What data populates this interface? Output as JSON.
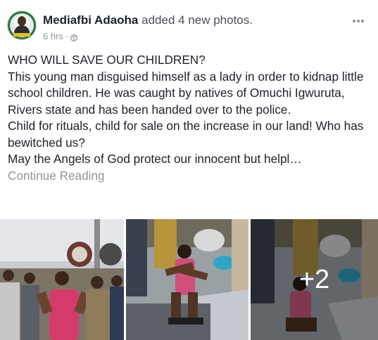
{
  "post": {
    "author": "Mediafbi Adaoha",
    "action": "added 4 new photos.",
    "timestamp": "6 hrs",
    "separator": "·",
    "privacy_icon": "globe-icon",
    "more_icon": "ellipsis-icon",
    "body_lines": [
      "WHO WILL SAVE OUR CHILDREN?",
      "This young man disguised himself as a lady in order to kidnap little school children. He was caught by natives of Omuchi Igwuruta, Rivers state and has been handed over to the police.",
      "Child for rituals, child for sale on the increase in our land! Who has bewitched us?",
      "May the Angels of God protect our innocent but helpl…"
    ],
    "continue_label": "Continue Reading",
    "photos": {
      "count_visible": 3,
      "more_overlay": "+2"
    }
  },
  "colors": {
    "author": "#1d2129",
    "secondary": "#90949c",
    "avatar_bg": "#1f7a3a"
  }
}
